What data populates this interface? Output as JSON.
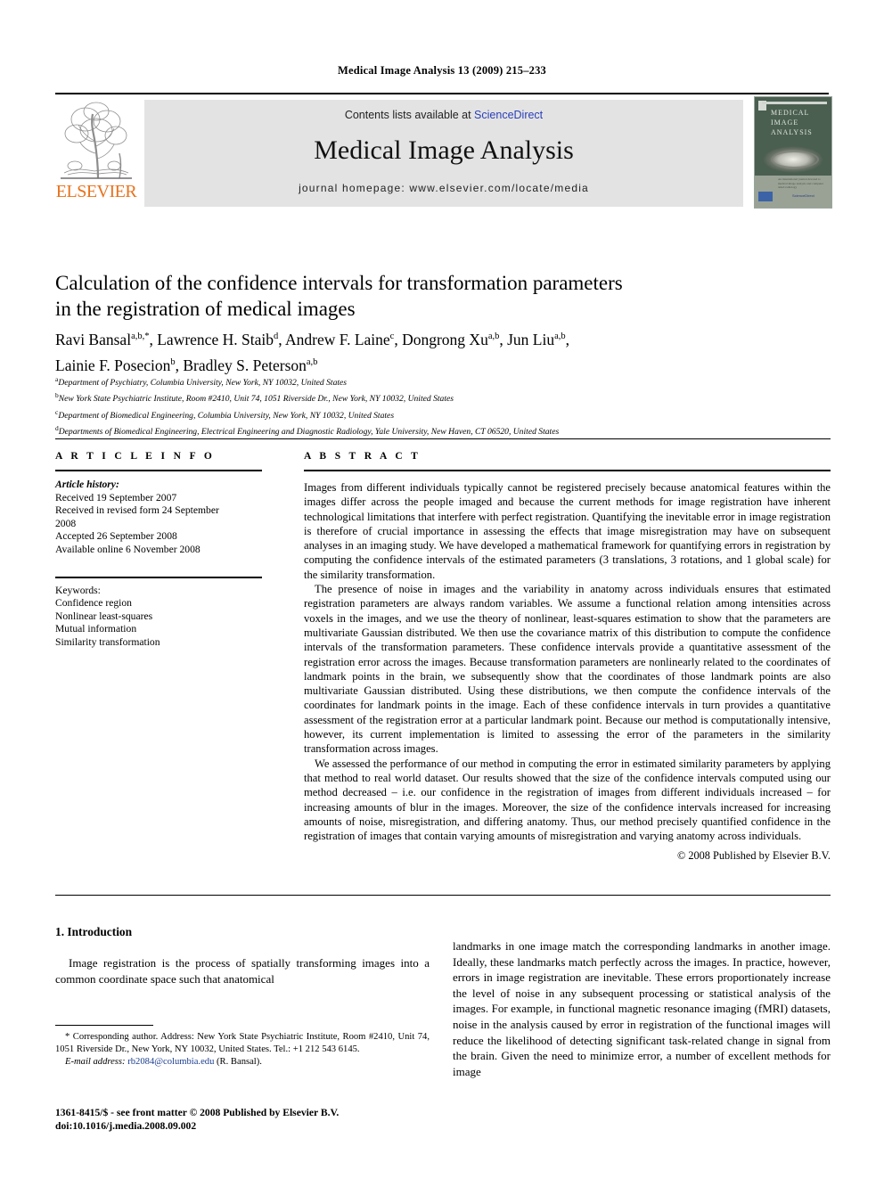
{
  "running_head": "Medical Image Analysis 13 (2009) 215–233",
  "banner": {
    "contents_prefix": "Contents lists available at ",
    "sciencedirect": "ScienceDirect",
    "journal_title": "Medical Image Analysis",
    "homepage": "journal homepage: www.elsevier.com/locate/media",
    "publisher": "ELSEVIER",
    "cover": {
      "line1": "MEDICAL",
      "line2": "IMAGE",
      "line3": "ANALYSIS",
      "blurb": "An international journal devoted to medical image analysis and computer aided radiology",
      "sciencedirect": "ScienceDirect"
    },
    "accent_link_color": "#2a3fb8",
    "elsevier_orange": "#e8721c",
    "cover_green": "#4a5f50",
    "banner_gray": "#e3e3e3"
  },
  "article": {
    "title_line1": "Calculation of the confidence intervals for transformation parameters",
    "title_line2": "in the registration of medical images",
    "authors": [
      {
        "name": "Ravi Bansal",
        "sup": "a,b,*"
      },
      {
        "name": "Lawrence H. Staib",
        "sup": "d"
      },
      {
        "name": "Andrew F. Laine",
        "sup": "c"
      },
      {
        "name": "Dongrong Xu",
        "sup": "a,b"
      },
      {
        "name": "Jun Liu",
        "sup": "a,b"
      },
      {
        "name": "Lainie F. Posecion",
        "sup": "b"
      },
      {
        "name": "Bradley S. Peterson",
        "sup": "a,b"
      }
    ],
    "affiliations": [
      {
        "label": "a",
        "text": "Department of Psychiatry, Columbia University, New York, NY 10032, United States"
      },
      {
        "label": "b",
        "text": "New York State Psychiatric Institute, Room #2410, Unit 74, 1051 Riverside Dr., New York, NY 10032, United States"
      },
      {
        "label": "c",
        "text": "Department of Biomedical Engineering, Columbia University, New York, NY 10032, United States"
      },
      {
        "label": "d",
        "text": "Departments of Biomedical Engineering, Electrical Engineering and Diagnostic Radiology, Yale University, New Haven, CT 06520, United States"
      }
    ]
  },
  "article_info": {
    "heading": "A R T I C L E    I N F O",
    "history_label": "Article history:",
    "history": [
      "Received 19 September 2007",
      "Received in revised form 24 September",
      "2008",
      "Accepted 26 September 2008",
      "Available online 6 November 2008"
    ],
    "keywords_label": "Keywords:",
    "keywords": [
      "Confidence region",
      "Nonlinear least-squares",
      "Mutual information",
      "Similarity transformation"
    ]
  },
  "abstract": {
    "heading": "A B S T R A C T",
    "paragraphs": [
      "Images from different individuals typically cannot be registered precisely because anatomical features within the images differ across the people imaged and because the current methods for image registration have inherent technological limitations that interfere with perfect registration. Quantifying the inevitable error in image registration is therefore of crucial importance in assessing the effects that image misregistration may have on subsequent analyses in an imaging study. We have developed a mathematical framework for quantifying errors in registration by computing the confidence intervals of the estimated parameters (3 translations, 3 rotations, and 1 global scale) for the similarity transformation.",
      "The presence of noise in images and the variability in anatomy across individuals ensures that estimated registration parameters are always random variables. We assume a functional relation among intensities across voxels in the images, and we use the theory of nonlinear, least-squares estimation to show that the parameters are multivariate Gaussian distributed. We then use the covariance matrix of this distribution to compute the confidence intervals of the transformation parameters. These confidence intervals provide a quantitative assessment of the registration error across the images. Because transformation parameters are nonlinearly related to the coordinates of landmark points in the brain, we subsequently show that the coordinates of those landmark points are also multivariate Gaussian distributed. Using these distributions, we then compute the confidence intervals of the coordinates for landmark points in the image. Each of these confidence intervals in turn provides a quantitative assessment of the registration error at a particular landmark point. Because our method is computationally intensive, however, its current implementation is limited to assessing the error of the parameters in the similarity transformation across images.",
      "We assessed the performance of our method in computing the error in estimated similarity parameters by applying that method to real world dataset. Our results showed that the size of the confidence intervals computed using our method decreased – i.e. our confidence in the registration of images from different individuals increased – for increasing amounts of blur in the images. Moreover, the size of the confidence intervals increased for increasing amounts of noise, misregistration, and differing anatomy. Thus, our method precisely quantified confidence in the registration of images that contain varying amounts of misregistration and varying anatomy across individuals."
    ],
    "copyright": "© 2008 Published by Elsevier B.V."
  },
  "body": {
    "section_heading": "1. Introduction",
    "left_paragraph": "Image registration is the process of spatially transforming images into a common coordinate space such that anatomical",
    "right_paragraph": "landmarks in one image match the corresponding landmarks in another image. Ideally, these landmarks match perfectly across the images. In practice, however, errors in image registration are inevitable. These errors proportionately increase the level of noise in any subsequent processing or statistical analysis of the images. For example, in functional magnetic resonance imaging (fMRI) datasets, noise in the analysis caused by error in registration of the functional images will reduce the likelihood of detecting significant task-related change in signal from the brain. Given the need to minimize error, a number of excellent methods for image"
  },
  "footnote": {
    "corresponding": "* Corresponding author. Address: New York State Psychiatric Institute, Room #2410, Unit 74, 1051 Riverside Dr., New York, NY 10032, United States. Tel.: +1 212 543 6145.",
    "email_label": "E-mail address:",
    "email": "rb2084@columbia.edu",
    "email_attrib": "(R. Bansal)."
  },
  "imprint": {
    "line1": "1361-8415/$ - see front matter © 2008 Published by Elsevier B.V.",
    "line2": "doi:10.1016/j.media.2008.09.002"
  }
}
